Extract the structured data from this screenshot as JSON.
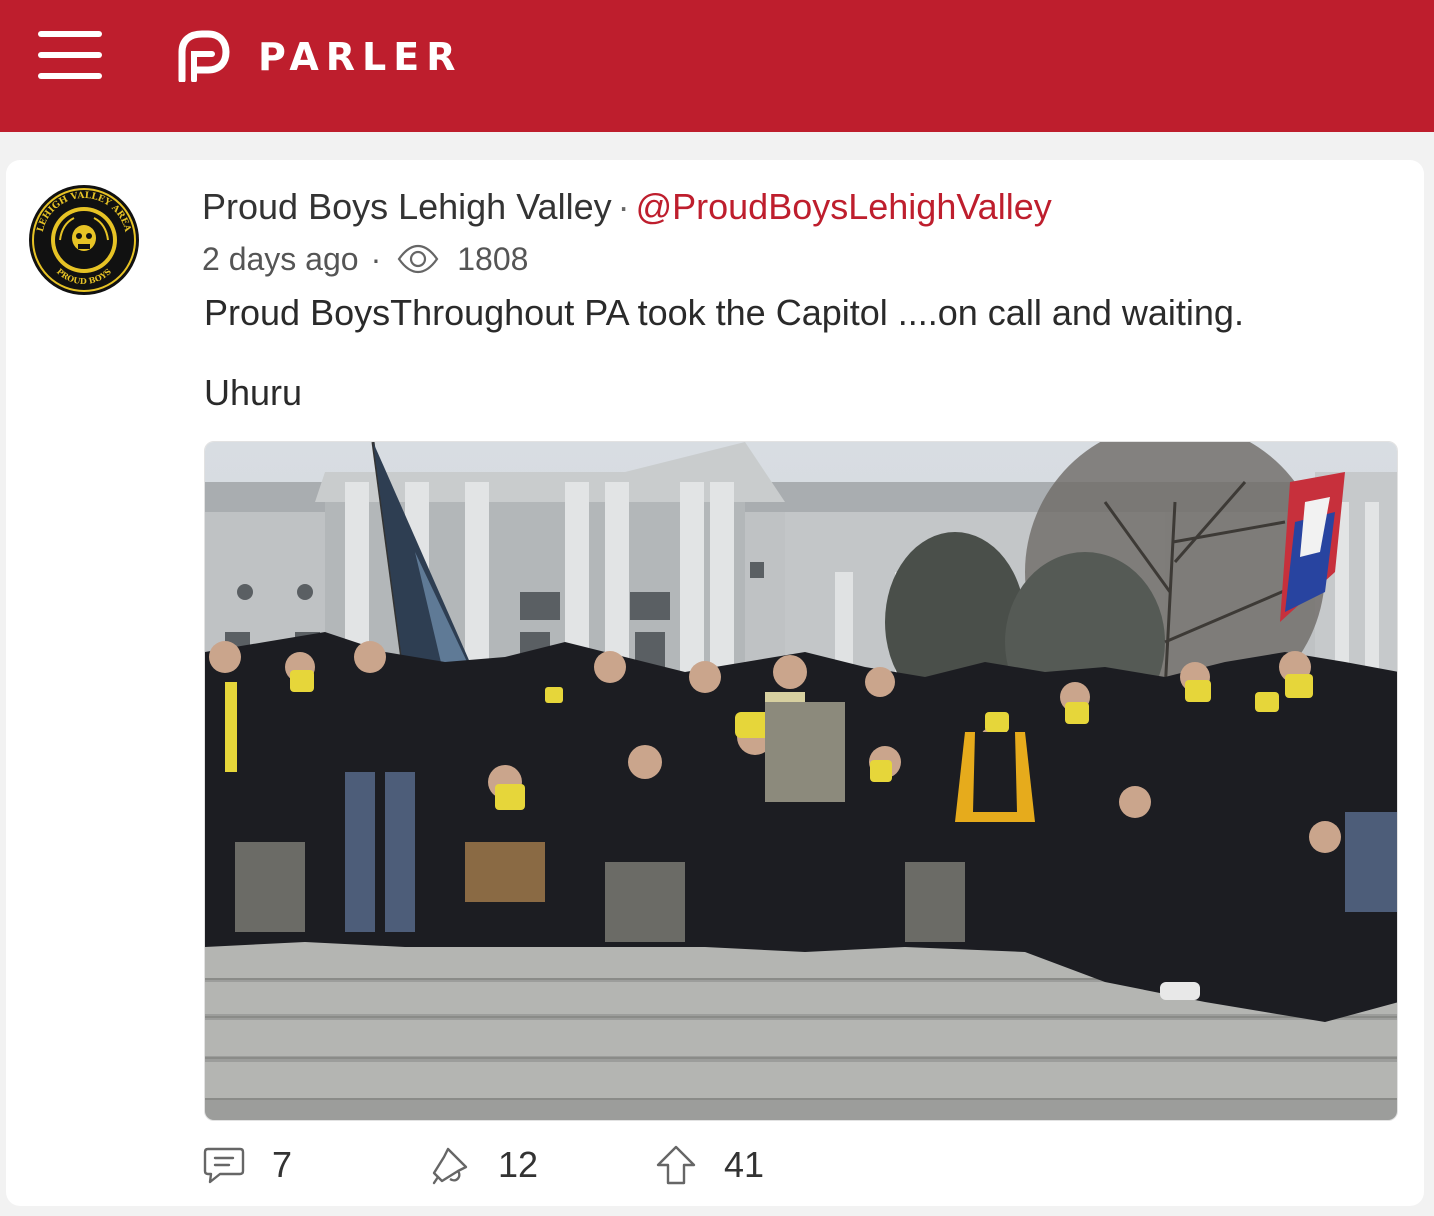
{
  "app": {
    "brand": "PARLER",
    "accent_color": "#be1e2d",
    "menu_icon": "hamburger-menu-icon",
    "logo_icon": "parler-p-logo-icon"
  },
  "post": {
    "author_name": "Proud Boys Lehigh Valley",
    "handle": "@ProudBoysLehighValley",
    "timestamp": "2 days ago",
    "views_icon": "eye-icon",
    "views": "1808",
    "text_lines": [
      "Proud BoysThroughout PA took the Capitol ....on call and waiting.",
      "Uhuru"
    ],
    "avatar_text": {
      "top": "LEHIGH VALLEY AREA",
      "bottom": "PROUD BOYS"
    },
    "actions": {
      "comments": "7",
      "echoes": "12",
      "upvotes": "41",
      "comment_icon": "comment-bubble-icon",
      "echo_icon": "echo-megaphone-icon",
      "upvote_icon": "upvote-arrow-icon"
    }
  }
}
